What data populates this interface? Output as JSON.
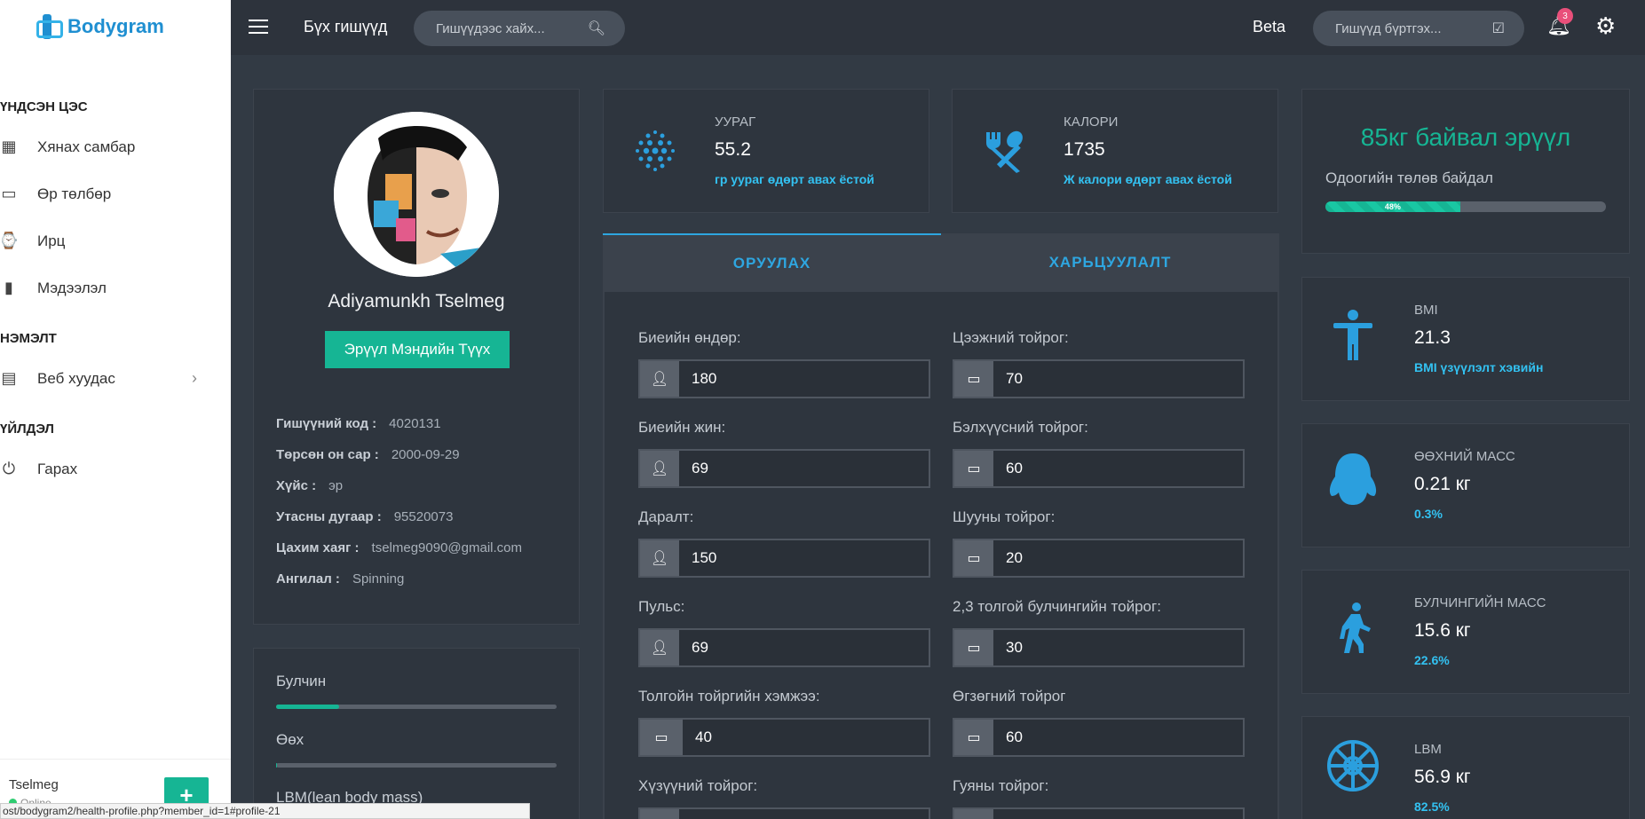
{
  "app": {
    "name": "Bodygram"
  },
  "sidebar": {
    "sections": [
      {
        "title": "ҮНДСЭН ЦЭС",
        "items": [
          "Хянах самбар",
          "Өр төлбөр",
          "Ирц",
          "Мэдээлэл"
        ]
      },
      {
        "title": "НЭМЭЛТ",
        "items": [
          "Веб хуудас"
        ]
      },
      {
        "title": "ҮЙЛДЭЛ",
        "items": [
          "Гарах"
        ]
      }
    ],
    "icons": [
      "dashboard-icon",
      "card-icon",
      "watch-icon",
      "chart-icon",
      "web-icon",
      "power-icon"
    ],
    "user": {
      "name": "Tselmeg",
      "status": "Online"
    },
    "add_label": "+"
  },
  "topbar": {
    "title": "Бүх гишүүд",
    "search_placeholder": "Гишүүдээс хайх...",
    "beta": "Beta",
    "register": "Гишүүд бүртгэх...",
    "notifications": "3"
  },
  "profile": {
    "name": "Adiyamunkh Tselmeg",
    "history_button": "Эрүүл Мэндийн Түүх",
    "info": [
      {
        "label": "Гишүүний код :",
        "value": "4020131"
      },
      {
        "label": "Төрсөн он сар :",
        "value": "2000-09-29"
      },
      {
        "label": "Хүйс :",
        "value": "эр"
      },
      {
        "label": "Утасны дугаар :",
        "value": "95520073"
      },
      {
        "label": "Цахим хаяг :",
        "value": "tselmeg9090@gmail.com"
      },
      {
        "label": "Ангилал :",
        "value": "Spinning"
      }
    ]
  },
  "composition": [
    {
      "label": "Булчин",
      "fraction": 0.226
    },
    {
      "label": "Өөх",
      "fraction": 0.003
    },
    {
      "label": "LBM(lean body mass)",
      "fraction": 0.825
    }
  ],
  "stats": {
    "protein": {
      "caption": "УУРАГ",
      "value": "55.2",
      "note": "гр уураг өдөрт авах ёстой"
    },
    "calorie": {
      "caption": "КАЛОРИ",
      "value": "1735",
      "note": "Ж калори өдөрт авах ёстой"
    }
  },
  "tabs": {
    "insert": "ОРУУЛАХ",
    "compare": "ХАРЬЦУУЛАЛТ"
  },
  "form": {
    "left": [
      {
        "label": "Биеийн өндөр:",
        "value": "180",
        "icon": "user-icon"
      },
      {
        "label": "Биеийн жин:",
        "value": "69",
        "icon": "user-icon"
      },
      {
        "label": "Даралт:",
        "value": "150",
        "icon": "user-icon"
      },
      {
        "label": "Пульс:",
        "value": "69",
        "icon": "user-icon"
      },
      {
        "label": "Толгойн тойргийн хэмжээ:",
        "value": "40",
        "icon": "ruler-icon"
      },
      {
        "label": "Хүзүүний тойрог:",
        "value": "",
        "icon": "ruler-icon"
      }
    ],
    "right": [
      {
        "label": "Цээжний тойрог:",
        "value": "70",
        "icon": "ruler-icon"
      },
      {
        "label": "Бэлхүүсний тойрог:",
        "value": "60",
        "icon": "ruler-icon"
      },
      {
        "label": "Шууны тойрог:",
        "value": "20",
        "icon": "ruler-icon"
      },
      {
        "label": "2,3 толгой булчингийн тойрог:",
        "value": "30",
        "icon": "ruler-icon"
      },
      {
        "label": "Өгзөгний тойрог",
        "value": "60",
        "icon": "ruler-icon"
      },
      {
        "label": "Гуяны тойрог:",
        "value": "",
        "icon": "ruler-icon"
      }
    ]
  },
  "health": {
    "title": "85кг байвал эрүүл",
    "subtitle": "Одоогийн төлөв байдал",
    "progress_label": "48%",
    "progress": 0.48
  },
  "side_stats": [
    {
      "caption": "BMI",
      "value": "21.3",
      "note": "BMI үзүүлэлт хэвийн",
      "icon": "person-icon"
    },
    {
      "caption": "ӨӨХНИЙ МАСС",
      "value": "0.21 кг",
      "note": "0.3%",
      "icon": "ghost-icon"
    },
    {
      "caption": "БУЛЧИНГИЙН МАСС",
      "value": "15.6 кг",
      "note": "22.6%",
      "icon": "walking-icon"
    },
    {
      "caption": "LBM",
      "value": "56.9 кг",
      "note": "82.5%",
      "icon": "empire-icon"
    }
  ],
  "statusbar": {
    "url": "ost/bodygram2/health-profile.php?member_id=1#profile-21"
  },
  "colors": {
    "accent": "#16b594",
    "blue": "#2ea6e0",
    "bg": "#323a44"
  }
}
